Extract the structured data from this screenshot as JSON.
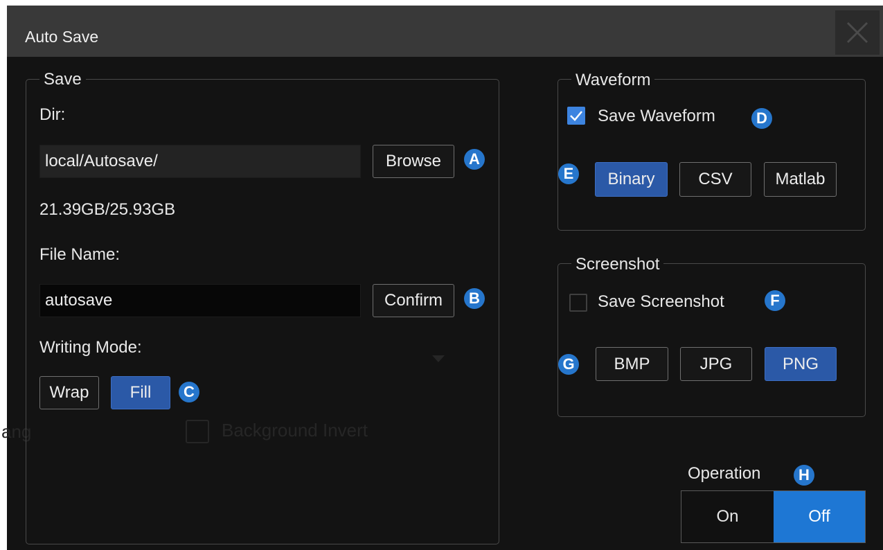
{
  "window": {
    "title": "Auto Save",
    "close_icon": "close-icon"
  },
  "background_ghost": {
    "left_text": "ang",
    "checkbox_label": "Background Invert"
  },
  "save": {
    "legend": "Save",
    "dir_label": "Dir:",
    "dir_value": "local/Autosave/",
    "browse_label": "Browse",
    "storage": "21.39GB/25.93GB",
    "file_name_label": "File Name:",
    "file_name_value": "autosave",
    "confirm_label": "Confirm",
    "writing_mode_label": "Writing Mode:",
    "modes": [
      {
        "label": "Wrap",
        "selected": false
      },
      {
        "label": "Fill",
        "selected": true
      }
    ]
  },
  "waveform": {
    "legend": "Waveform",
    "save_label": "Save Waveform",
    "save_checked": true,
    "formats": [
      {
        "label": "Binary",
        "selected": true
      },
      {
        "label": "CSV",
        "selected": false
      },
      {
        "label": "Matlab",
        "selected": false
      }
    ]
  },
  "screenshot": {
    "legend": "Screenshot",
    "save_label": "Save Screenshot",
    "save_checked": false,
    "formats": [
      {
        "label": "BMP",
        "selected": false
      },
      {
        "label": "JPG",
        "selected": false
      },
      {
        "label": "PNG",
        "selected": true
      }
    ]
  },
  "operation": {
    "label": "Operation",
    "options": [
      {
        "label": "On",
        "selected": false
      },
      {
        "label": "Off",
        "selected": true
      }
    ]
  },
  "callouts": {
    "a": "A",
    "b": "B",
    "c": "C",
    "d": "D",
    "e": "E",
    "f": "F",
    "g": "G",
    "h": "H"
  },
  "colors": {
    "accent": "#1e77d4",
    "selected_button": "#2b59a7",
    "badge": "#2676cc",
    "background": "#131313"
  }
}
